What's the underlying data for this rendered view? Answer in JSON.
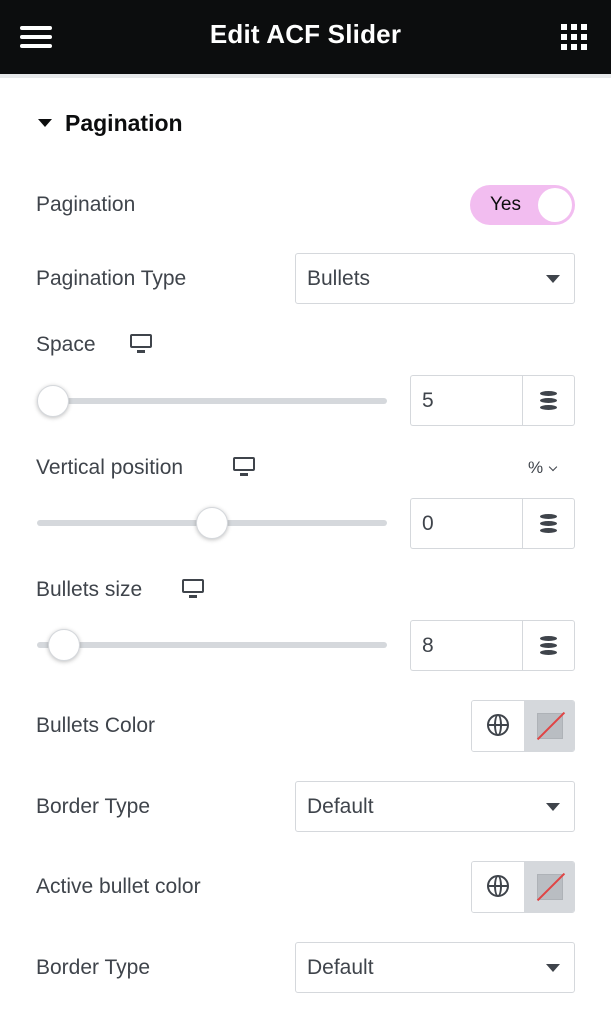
{
  "header": {
    "title": "Edit ACF Slider",
    "menu_icon": "hamburger-icon",
    "widgets_icon": "grid-icon",
    "background": "#0c0d0e"
  },
  "section": {
    "title": "Pagination",
    "expanded": true
  },
  "controls": {
    "pagination": {
      "label": "Pagination",
      "toggle_label": "Yes",
      "checked": true,
      "accent": "#f2bdf0"
    },
    "pagination_type": {
      "label": "Pagination Type",
      "value": "Bullets"
    },
    "space": {
      "label": "Space",
      "value": "5",
      "slider_fraction": 0.05,
      "device_icon": "desktop-icon"
    },
    "vertical_position": {
      "label": "Vertical position",
      "value": "0",
      "unit": "%",
      "slider_fraction": 0.5,
      "device_icon": "desktop-icon"
    },
    "bullets_size": {
      "label": "Bullets size",
      "value": "8",
      "slider_fraction": 0.08,
      "device_icon": "desktop-icon"
    },
    "bullets_color": {
      "label": "Bullets Color",
      "global_icon": "globe-icon",
      "swatch_state": "none"
    },
    "border_type_1": {
      "label": "Border Type",
      "value": "Default"
    },
    "active_bullet_color": {
      "label": "Active bullet color",
      "global_icon": "globe-icon",
      "swatch_state": "none"
    },
    "border_type_2": {
      "label": "Border Type",
      "value": "Default"
    }
  }
}
